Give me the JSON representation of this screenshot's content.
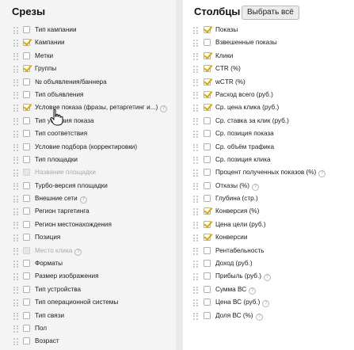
{
  "slices": {
    "title": "Срезы",
    "items": [
      {
        "label": "Тип кампании",
        "checked": false,
        "disabled": false,
        "help": false
      },
      {
        "label": "Кампании",
        "checked": true,
        "disabled": false,
        "help": false
      },
      {
        "label": "Метки",
        "checked": false,
        "disabled": false,
        "help": false
      },
      {
        "label": "Группы",
        "checked": true,
        "disabled": false,
        "help": false
      },
      {
        "label": "№ объявления/баннера",
        "checked": false,
        "disabled": false,
        "help": false
      },
      {
        "label": "Тип объявления",
        "checked": false,
        "disabled": false,
        "help": false
      },
      {
        "label": "Условие показа (фразы, ретаргетинг и...)",
        "checked": true,
        "disabled": false,
        "help": true
      },
      {
        "label": "Тип условия показа",
        "checked": false,
        "disabled": false,
        "help": false
      },
      {
        "label": "Тип соответствия",
        "checked": false,
        "disabled": false,
        "help": false
      },
      {
        "label": "Условие подбора (корректировки)",
        "checked": false,
        "disabled": false,
        "help": false
      },
      {
        "label": "Тип площадки",
        "checked": false,
        "disabled": false,
        "help": false
      },
      {
        "label": "Название площадки",
        "checked": false,
        "disabled": true,
        "help": false
      },
      {
        "label": "Турбо-версия площадки",
        "checked": false,
        "disabled": false,
        "help": false
      },
      {
        "label": "Внешние сети",
        "checked": false,
        "disabled": false,
        "help": true
      },
      {
        "label": "Регион таргетинга",
        "checked": false,
        "disabled": false,
        "help": false
      },
      {
        "label": "Регион местонахождения",
        "checked": false,
        "disabled": false,
        "help": false
      },
      {
        "label": "Позиция",
        "checked": false,
        "disabled": false,
        "help": false
      },
      {
        "label": "Место клика",
        "checked": false,
        "disabled": true,
        "help": true
      },
      {
        "label": "Форматы",
        "checked": false,
        "disabled": false,
        "help": false
      },
      {
        "label": "Размер изображения",
        "checked": false,
        "disabled": false,
        "help": false
      },
      {
        "label": "Тип устройства",
        "checked": false,
        "disabled": false,
        "help": false
      },
      {
        "label": "Тип операционной системы",
        "checked": false,
        "disabled": false,
        "help": false
      },
      {
        "label": "Тип связи",
        "checked": false,
        "disabled": false,
        "help": false
      },
      {
        "label": "Пол",
        "checked": false,
        "disabled": false,
        "help": false
      },
      {
        "label": "Возраст",
        "checked": false,
        "disabled": false,
        "help": false
      }
    ]
  },
  "columns": {
    "title": "Столбцы",
    "select_all_label": "Выбрать всё",
    "items": [
      {
        "label": "Показы",
        "checked": true,
        "help": false
      },
      {
        "label": "Взвешенные показы",
        "checked": false,
        "help": false
      },
      {
        "label": "Клики",
        "checked": true,
        "help": false
      },
      {
        "label": "CTR (%)",
        "checked": true,
        "help": false
      },
      {
        "label": "wCTR (%)",
        "checked": true,
        "help": false
      },
      {
        "label": "Расход всего (руб.)",
        "checked": true,
        "help": false
      },
      {
        "label": "Ср. цена клика (руб.)",
        "checked": true,
        "help": false
      },
      {
        "label": "Ср. ставка за клик (руб.)",
        "checked": false,
        "help": false
      },
      {
        "label": "Ср. позиция показа",
        "checked": false,
        "help": false
      },
      {
        "label": "Ср. объём трафика",
        "checked": false,
        "help": false
      },
      {
        "label": "Ср. позиция клика",
        "checked": false,
        "help": false
      },
      {
        "label": "Процент полученных показов (%)",
        "checked": false,
        "help": true
      },
      {
        "label": "Отказы (%)",
        "checked": false,
        "help": true
      },
      {
        "label": "Глубина (стр.)",
        "checked": false,
        "help": false
      },
      {
        "label": "Конверсия (%)",
        "checked": true,
        "help": false
      },
      {
        "label": "Цена цели (руб.)",
        "checked": true,
        "help": false
      },
      {
        "label": "Конверсии",
        "checked": true,
        "help": false
      },
      {
        "label": "Рентабельность",
        "checked": false,
        "help": false
      },
      {
        "label": "Доход (руб.)",
        "checked": false,
        "help": false
      },
      {
        "label": "Прибыль (руб.)",
        "checked": false,
        "help": true
      },
      {
        "label": "Сумма ВС",
        "checked": false,
        "help": true
      },
      {
        "label": "Цена ВС (руб.)",
        "checked": false,
        "help": true
      },
      {
        "label": "Доля ВС (%)",
        "checked": false,
        "help": true
      }
    ]
  },
  "colors": {
    "accent_check": "#e0a800",
    "checkbox_border": "#b0b0b0",
    "disabled_text": "#a8a8a8"
  }
}
